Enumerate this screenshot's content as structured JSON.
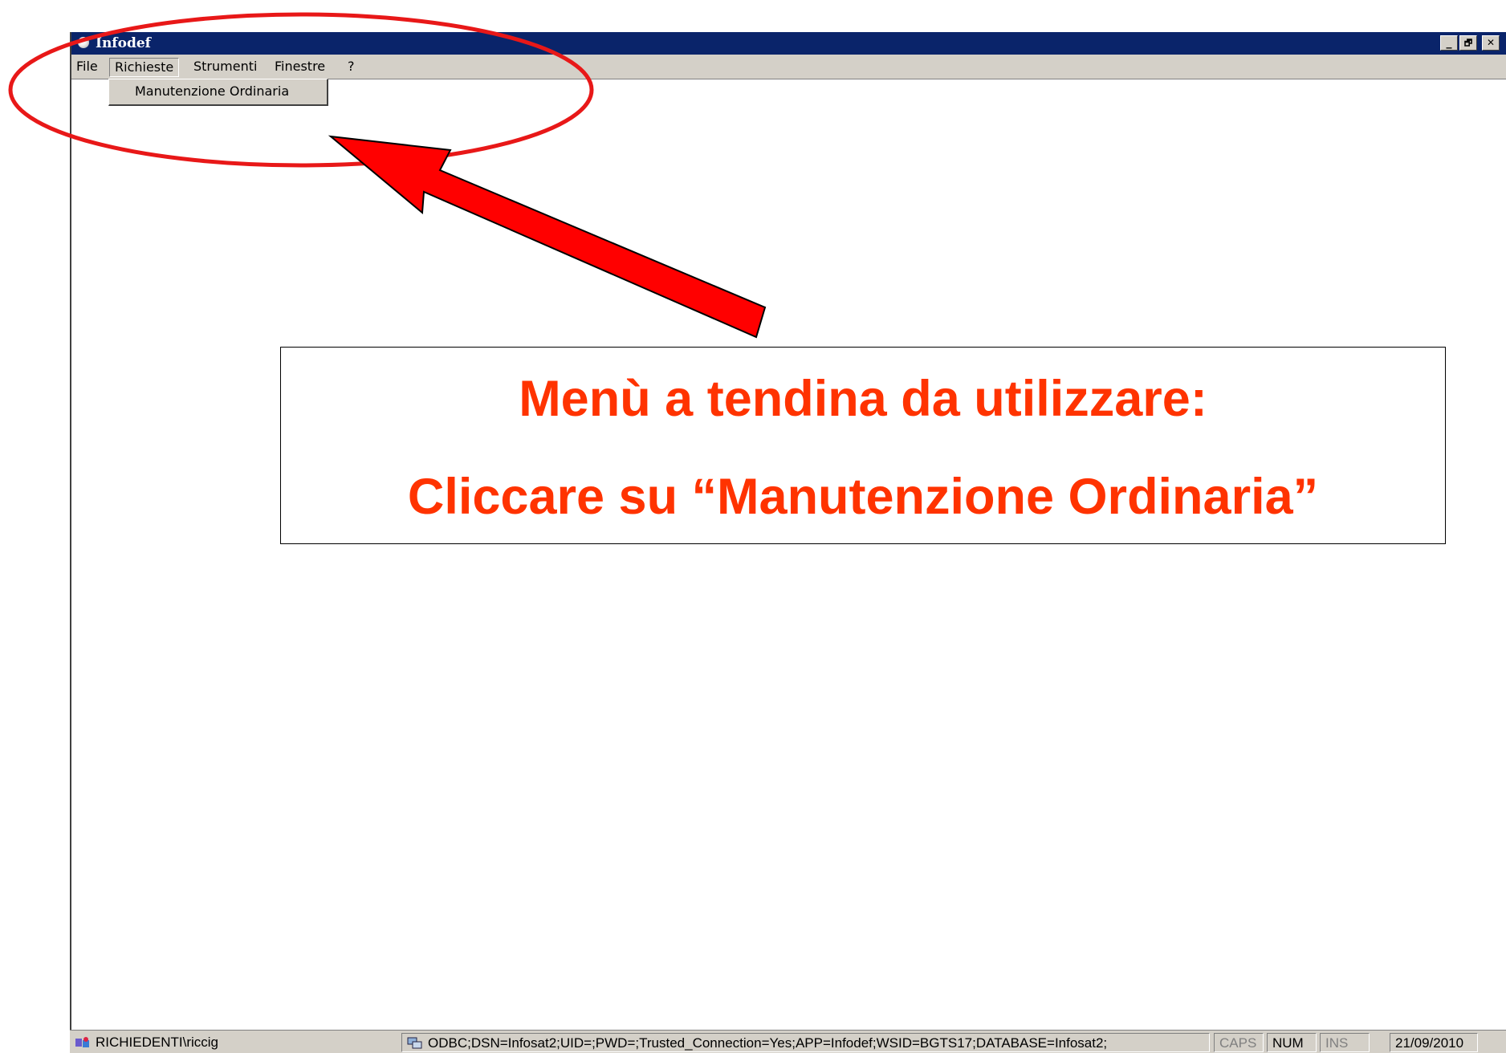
{
  "window": {
    "title": "Infodef",
    "minimize_label": "_",
    "restore_label": "🗗",
    "close_label": "✕"
  },
  "menu": {
    "items": [
      {
        "label": "File"
      },
      {
        "label": "Richieste"
      },
      {
        "label": "Strumenti"
      },
      {
        "label": "Finestre"
      },
      {
        "label": "?"
      }
    ],
    "dropdown": {
      "items": [
        {
          "label": "Manutenzione Ordinaria"
        }
      ]
    }
  },
  "annotation": {
    "line1": "Menù a tendina da utilizzare:",
    "line2": "Cliccare su “Manutenzione Ordinaria”",
    "color": "#ff3300"
  },
  "statusbar": {
    "user": "RICHIEDENTI\\riccig",
    "connection": "ODBC;DSN=Infosat2;UID=;PWD=;Trusted_Connection=Yes;APP=Infodef;WSID=BGTS17;DATABASE=Infosat2;",
    "caps": "CAPS",
    "num": "NUM",
    "ins": "INS",
    "date": "21/09/2010"
  }
}
